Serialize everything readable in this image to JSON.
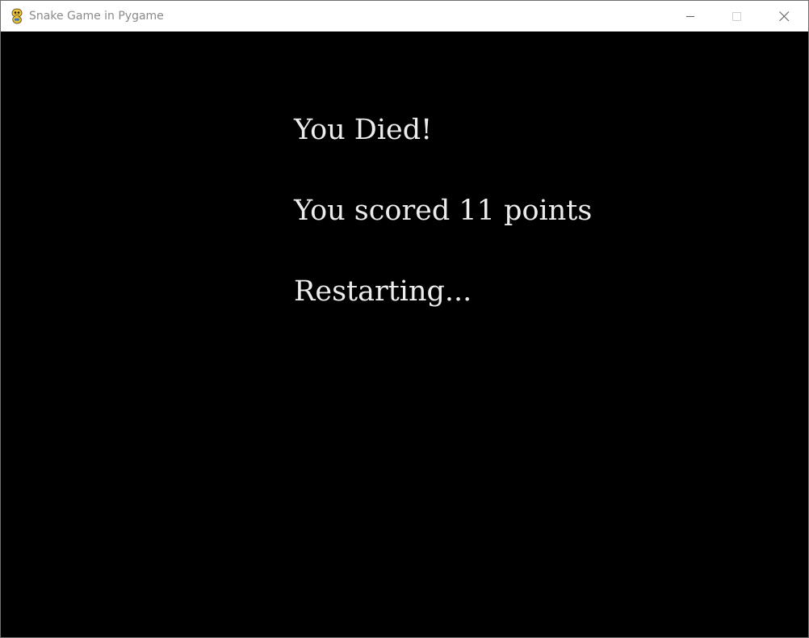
{
  "window": {
    "title": "Snake Game in Pygame",
    "icon": "pygame-snake-icon"
  },
  "controls": {
    "minimize_icon": "minimize-icon",
    "maximize_icon": "maximize-icon",
    "close_icon": "close-icon"
  },
  "game": {
    "background": "#000000",
    "text_color": "#ececec",
    "messages": {
      "died": "You Died!",
      "score": "You scored 11 points",
      "restart": "Restarting..."
    }
  }
}
